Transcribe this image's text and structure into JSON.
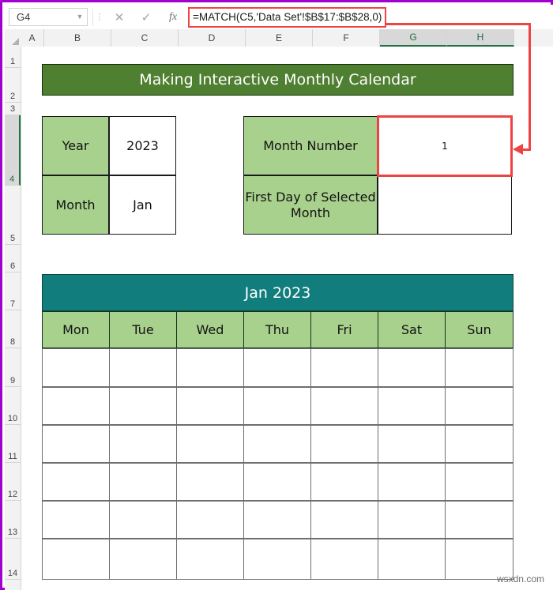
{
  "window": {
    "accent_purple": "#a200d0",
    "annotation_red": "#ee4343"
  },
  "formula_bar": {
    "name_box_value": "G4",
    "name_box_caret": "▼",
    "more_icon": "⋮",
    "cancel_icon": "✕",
    "enter_icon": "✓",
    "function_icon": "fx",
    "formula": "=MATCH(C5,'Data Set'!$B$17:$B$28,0)"
  },
  "grid": {
    "columns": [
      "A",
      "B",
      "C",
      "D",
      "E",
      "F",
      "G",
      "H"
    ],
    "selected_columns": [
      "G",
      "H"
    ],
    "rows": [
      "1",
      "2",
      "3",
      "4",
      "5",
      "6",
      "7",
      "8",
      "9",
      "10",
      "11",
      "12",
      "13",
      "14"
    ],
    "selected_rows": [
      "4"
    ]
  },
  "sheet": {
    "title": "Making Interactive Monthly Calendar",
    "year_label": "Year",
    "year_value": "2023",
    "month_label": "Month",
    "month_value": "Jan",
    "month_number_label": "Month Number",
    "month_number_value": "1",
    "first_day_label": "First Day of Selected Month",
    "first_day_value": "",
    "calendar_title": "Jan 2023",
    "day_names": [
      "Mon",
      "Tue",
      "Wed",
      "Thu",
      "Fri",
      "Sat",
      "Sun"
    ],
    "calendar_week_count": 6
  },
  "colors": {
    "banner_green": "#4f7f31",
    "label_green": "#a9d18e",
    "calendar_teal": "#127d7d"
  },
  "watermark": "wsxdn.com"
}
